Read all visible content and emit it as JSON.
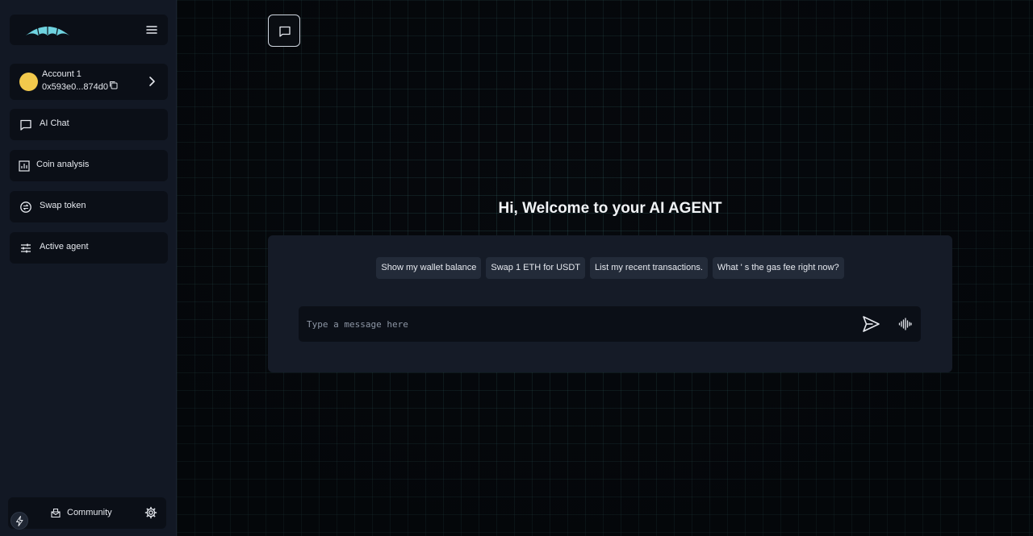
{
  "sidebar": {
    "account": {
      "name": "Account 1",
      "address": "0x593e0...874d0"
    },
    "items": [
      {
        "label": "AI Chat",
        "icon": "chat-bubble-icon"
      },
      {
        "label": "Coin analysis",
        "icon": "bar-chart-icon"
      },
      {
        "label": "Swap token",
        "icon": "swap-circle-icon"
      },
      {
        "label": "Active agent",
        "icon": "sliders-icon"
      }
    ],
    "footer": {
      "community_label": "Community"
    }
  },
  "main": {
    "welcome": "Hi, Welcome to your AI AGENT",
    "suggestions": [
      "Show my wallet balance",
      "Swap 1 ETH for USDT",
      "List my recent transactions.",
      "What ' s the gas fee right now?"
    ],
    "input": {
      "value": "",
      "placeholder": "Type a message here"
    }
  },
  "colors": {
    "accent": "#6fd3e0",
    "avatar": "#f2c94c",
    "sidebar_bg": "#121824",
    "panel_bg": "#151b27"
  }
}
